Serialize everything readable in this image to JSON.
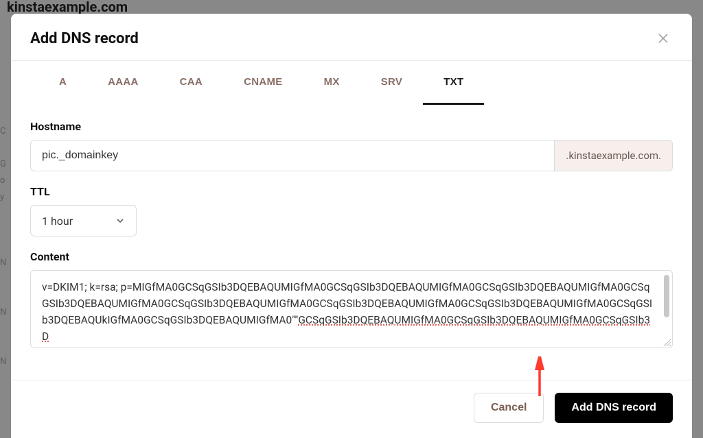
{
  "backdrop_title": "kinstaexample.com",
  "modal": {
    "title": "Add DNS record",
    "tabs": [
      "A",
      "AAAA",
      "CAA",
      "CNAME",
      "MX",
      "SRV",
      "TXT"
    ],
    "active_tab": "TXT",
    "hostname": {
      "label": "Hostname",
      "value": "pic._domainkey",
      "suffix": ".kinstaexample.com."
    },
    "ttl": {
      "label": "TTL",
      "value": "1 hour"
    },
    "content": {
      "label": "Content",
      "value_prefix": "v=DKIM1; k=rsa; p=MIGfMA0GCSqGSIb3DQEBAQUMIGfMA0GCSqGSIb3DQEBAQUMIGfMA0GCSqGSIb3DQEBAQUMIGfMA0GCSqGSIb3DQEBAQUMIGfMA0GCSqGSIb3DQEBAQUMIGfMA0GCSqGSIb3DQEBAQUMIGfMA0GCSqGSIb3DQEBAQUMIGfMA0GCSqGSIb3DQEBAQUkIGfMA0GCSqGSIb3DQEBAQUMIGfMA0\"\"",
      "value_underlined": "GCSqGSIb3DQEBAQUMIGfMA0GCSqGSIb3DQEBAQUMIGfMA0GCSqGSIb3D",
      "full_value": "v=DKIM1; k=rsa; p=MIGfMA0GCSqGSIb3DQEBAQUMIGfMA0GCSqGSIb3DQEBAQUMIGfMA0GCSqGSIb3DQEBAQUMIGfMA0GCSqGSIb3DQEBAQUMIGfMA0GCSqGSIb3DQEBAQUMIGfMA0GCSqGSIb3DQEBAQUMIGfMA0GCSqGSIb3DQEBAQUMIGfMA0GCSqGSIb3DQEBAQUkIGfMA0GCSqGSIb3DQEBAQUMIGfMA0\"\"GCSqGSIb3DQEBAQUMIGfMA0GCSqGSIb3DQEBAQUMIGfMA0GCSqGSIb3D"
    },
    "footer": {
      "cancel": "Cancel",
      "submit": "Add DNS record"
    }
  },
  "annotation_arrow_color": "#ff3b30"
}
